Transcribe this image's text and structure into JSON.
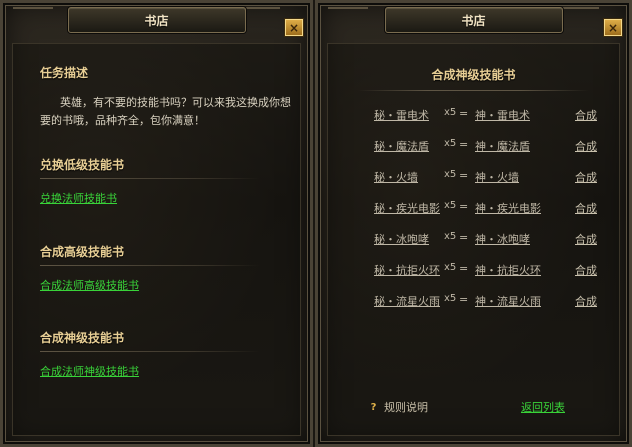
{
  "left": {
    "title": "书店",
    "close_label": "×",
    "task_heading": "任务描述",
    "task_line1": "英雄，有不要的技能书吗？可以来我这换成你想",
    "task_line2": "要的书哦，品种齐全，包你满意！",
    "sections": [
      {
        "heading": "兑换低级技能书",
        "link": "兑换法师技能书"
      },
      {
        "heading": "合成高级技能书",
        "link": "合成法师高级技能书"
      },
      {
        "heading": "合成神级技能书",
        "link": "合成法师神级技能书"
      }
    ]
  },
  "right": {
    "title": "书店",
    "close_label": "×",
    "heading": "合成神级技能书",
    "rows": [
      {
        "src": "秘・雷电术",
        "qty": "x5",
        "eq": "=",
        "dst": "神・雷电术",
        "action": "合成"
      },
      {
        "src": "秘・魔法盾",
        "qty": "x5",
        "eq": "=",
        "dst": "神・魔法盾",
        "action": "合成"
      },
      {
        "src": "秘・火墙",
        "qty": "x5",
        "eq": "=",
        "dst": "神・火墙",
        "action": "合成"
      },
      {
        "src": "秘・疾光电影",
        "qty": "x5",
        "eq": "=",
        "dst": "神・疾光电影",
        "action": "合成"
      },
      {
        "src": "秘・冰咆哮",
        "qty": "x5",
        "eq": "=",
        "dst": "神・冰咆哮",
        "action": "合成"
      },
      {
        "src": "秘・抗拒火环",
        "qty": "x5",
        "eq": "=",
        "dst": "神・抗拒火环",
        "action": "合成"
      },
      {
        "src": "秘・流星火雨",
        "qty": "x5",
        "eq": "=",
        "dst": "神・流星火雨",
        "action": "合成"
      }
    ],
    "help_icon": "?",
    "help_label": "规则说明",
    "back_label": "返回列表"
  }
}
